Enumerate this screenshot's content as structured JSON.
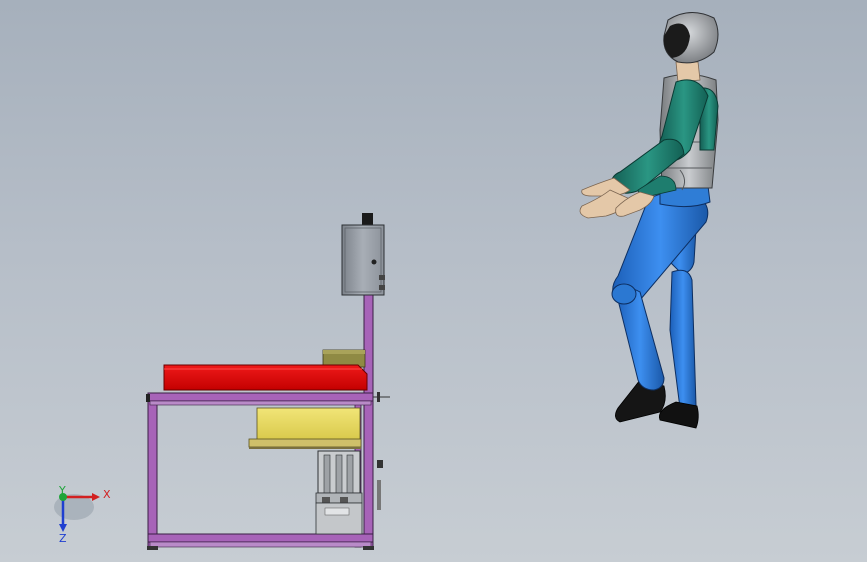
{
  "viewport": {
    "background_top": "#a6b0bc",
    "background_bottom": "#c7cdd3"
  },
  "assembly": {
    "components": [
      "frame",
      "control-box",
      "red-tray",
      "olive-block",
      "yellow-drum",
      "slide-mechanism",
      "human-figure"
    ],
    "colors": {
      "frame": "#a763b8",
      "tray": "#e00000",
      "drum": "#e7d85a",
      "box": "#9aa1aa",
      "torso": "#8c8f92",
      "arms": "#1e7d6e",
      "legs": "#2f7dd6",
      "skin": "#e4c8a8",
      "shoes": "#111111"
    }
  },
  "triad": {
    "x_label": "X",
    "y_label": "Y",
    "z_label": "Z",
    "x_color": "#d22020",
    "y_color": "#1fa43a",
    "z_color": "#1f3fd0"
  }
}
